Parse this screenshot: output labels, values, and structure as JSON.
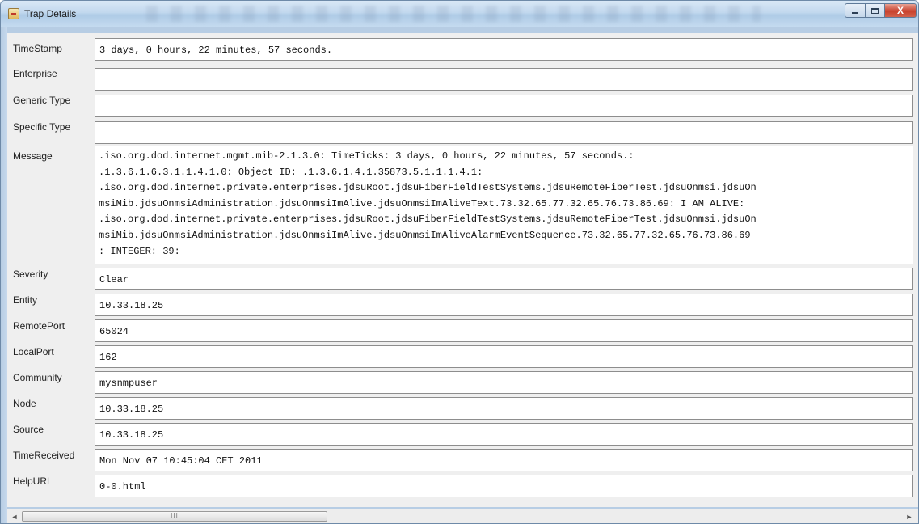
{
  "window": {
    "title": "Trap Details",
    "controls": {
      "minimize": "–",
      "maximize": "□",
      "close": "X"
    }
  },
  "fields": {
    "timestamp": {
      "label": "TimeStamp",
      "value": "3 days, 0 hours, 22 minutes, 57 seconds."
    },
    "enterprise": {
      "label": "Enterprise",
      "value": ""
    },
    "generic_type": {
      "label": "Generic Type",
      "value": ""
    },
    "specific_type": {
      "label": "Specific Type",
      "value": ""
    },
    "message": {
      "label": "Message",
      "lines": [
        ".iso.org.dod.internet.mgmt.mib-2.1.3.0:  TimeTicks:  3 days, 0 hours, 22 minutes, 57 seconds.:",
        ".1.3.6.1.6.3.1.1.4.1.0:  Object ID:  .1.3.6.1.4.1.35873.5.1.1.1.4.1:",
        ".iso.org.dod.internet.private.enterprises.jdsuRoot.jdsuFiberFieldTestSystems.jdsuRemoteFiberTest.jdsuOnmsi.jdsuOn",
        "msiMib.jdsuOnmsiAdministration.jdsuOnmsiImAlive.jdsuOnmsiImAliveText.73.32.65.77.32.65.76.73.86.69:  I AM ALIVE:",
        ".iso.org.dod.internet.private.enterprises.jdsuRoot.jdsuFiberFieldTestSystems.jdsuRemoteFiberTest.jdsuOnmsi.jdsuOn",
        "msiMib.jdsuOnmsiAdministration.jdsuOnmsiImAlive.jdsuOnmsiImAliveAlarmEventSequence.73.32.65.77.32.65.76.73.86.69",
        ":  INTEGER:  39:"
      ]
    },
    "severity": {
      "label": "Severity",
      "value": "Clear"
    },
    "entity": {
      "label": "Entity",
      "value": "10.33.18.25"
    },
    "remote_port": {
      "label": "RemotePort",
      "value": "65024"
    },
    "local_port": {
      "label": "LocalPort",
      "value": "162"
    },
    "community": {
      "label": "Community",
      "value": "mysnmpuser"
    },
    "node": {
      "label": "Node",
      "value": "10.33.18.25"
    },
    "source": {
      "label": "Source",
      "value": "10.33.18.25"
    },
    "time_received": {
      "label": "TimeReceived",
      "value": "Mon Nov 07 10:45:04 CET 2011"
    },
    "help_url": {
      "label": "HelpURL",
      "value": "0-0.html"
    }
  },
  "scrollbar": {
    "left_arrow": "◄",
    "right_arrow": "►",
    "thumb_grip": "III"
  },
  "colors": {
    "titlebar": "#c2d8ee",
    "close_button": "#c8412d",
    "field_border": "#8d8d8d",
    "client_bg": "#efefef"
  }
}
